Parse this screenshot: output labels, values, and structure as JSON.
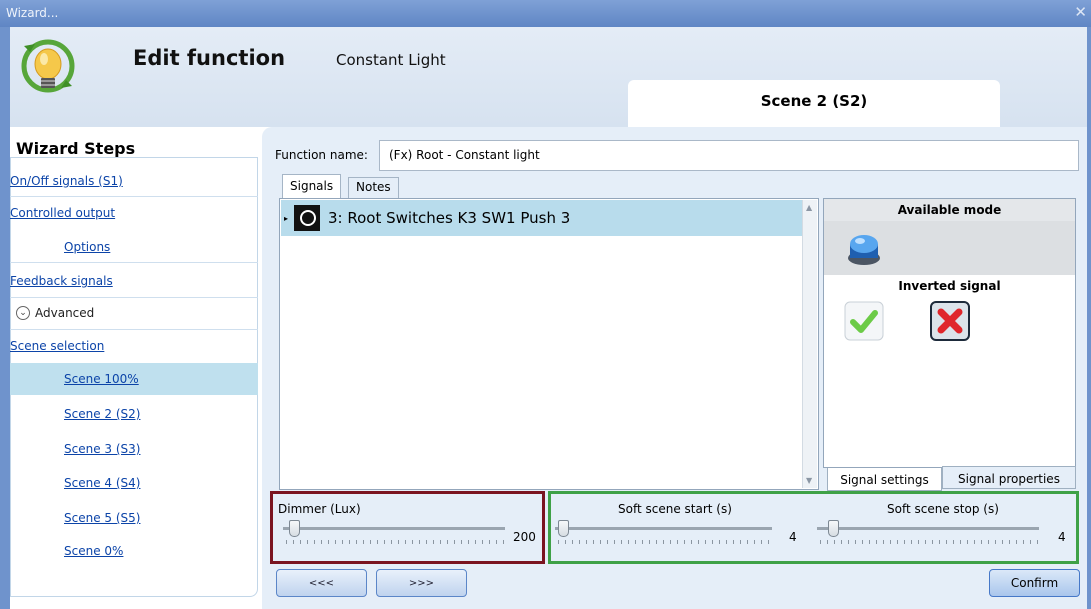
{
  "window": {
    "title": "Wizard...",
    "close_glyph": "✕"
  },
  "header": {
    "title": "Edit function",
    "subtitle": "Constant Light",
    "scene_tab": "Scene 2 (S2)",
    "logo_icon": "lightbulb-cycle-icon"
  },
  "sidebar": {
    "heading": "Wizard Steps",
    "items": [
      {
        "label": "On/Off signals (S1)"
      },
      {
        "label": "Controlled output"
      },
      {
        "label": "Options"
      },
      {
        "label": "Feedback signals"
      },
      {
        "label": "Advanced"
      },
      {
        "label": "Scene selection"
      },
      {
        "label": "Scene 100%"
      },
      {
        "label": "Scene 2 (S2)"
      },
      {
        "label": "Scene 3 (S3)"
      },
      {
        "label": "Scene 4 (S4)"
      },
      {
        "label": "Scene 5 (S5)"
      },
      {
        "label": "Scene 0%"
      }
    ]
  },
  "function_name": {
    "label": "Function name:",
    "value": "(Fx) Root - Constant light"
  },
  "tabs": [
    {
      "label": "Signals"
    },
    {
      "label": "Notes"
    }
  ],
  "signals": [
    {
      "label": "3: Root Switches K3 SW1 Push 3"
    }
  ],
  "mode_panel": {
    "available_mode": "Available mode",
    "inverted_signal": "Inverted signal",
    "colors": {
      "accept": "#5cbf3a",
      "reject": "#d9262a",
      "mode_button": "#2f7fd6"
    }
  },
  "settings_tabs": [
    {
      "label": "Signal settings"
    },
    {
      "label": "Signal properties"
    }
  ],
  "dimmer": {
    "label": "Dimmer (Lux)",
    "value": "200"
  },
  "soft_start": {
    "label": "Soft scene start (s)",
    "value": "4"
  },
  "soft_stop": {
    "label": "Soft scene stop (s)",
    "value": "4"
  },
  "nav": {
    "back": "<<<",
    "next": ">>>",
    "confirm": "Confirm"
  },
  "highlight_colors": {
    "dimmer_box": "#7a1420",
    "soft_box": "#3ea147"
  }
}
